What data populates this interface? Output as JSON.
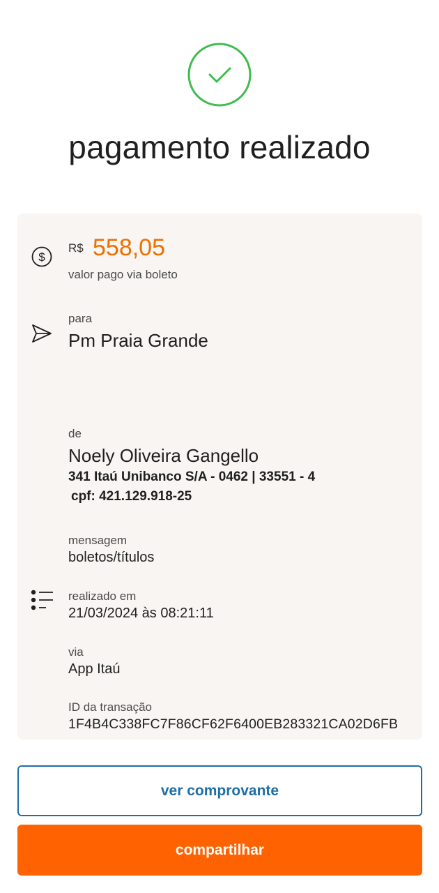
{
  "header": {
    "title": "pagamento realizado"
  },
  "payment": {
    "currency": "R$",
    "amount": "558,05",
    "amount_caption": "valor pago via boleto"
  },
  "recipient": {
    "label": "para",
    "name": "Pm Praia Grande"
  },
  "payer": {
    "label": "de",
    "name": "Noely Oliveira Gangello",
    "bank_info": "341 Itaú Unibanco S/A - 0462 | 33551 - 4",
    "cpf": "cpf: 421.129.918-25"
  },
  "details": {
    "message_label": "mensagem",
    "message_value": "boletos/títulos",
    "date_label": "realizado em",
    "date_value": "21/03/2024 às 08:21:11",
    "via_label": "via",
    "via_value": "App Itaú",
    "transaction_label": "ID da transação",
    "transaction_value": "1F4B4C338FC7F86CF62F6400EB283321CA02D6FB"
  },
  "actions": {
    "view_receipt_label": "ver comprovante",
    "share_label": "compartilhar"
  },
  "icons": {
    "success": "check-circle-icon",
    "amount": "dollar-circle-icon",
    "recipient": "send-icon",
    "details": "list-icon"
  },
  "colors": {
    "success_green": "#3ebd4f",
    "amount_orange": "#ec7000",
    "primary_button": "#ff6200",
    "outline_blue": "#1e6ea6",
    "card_background": "#f8f5f2"
  }
}
